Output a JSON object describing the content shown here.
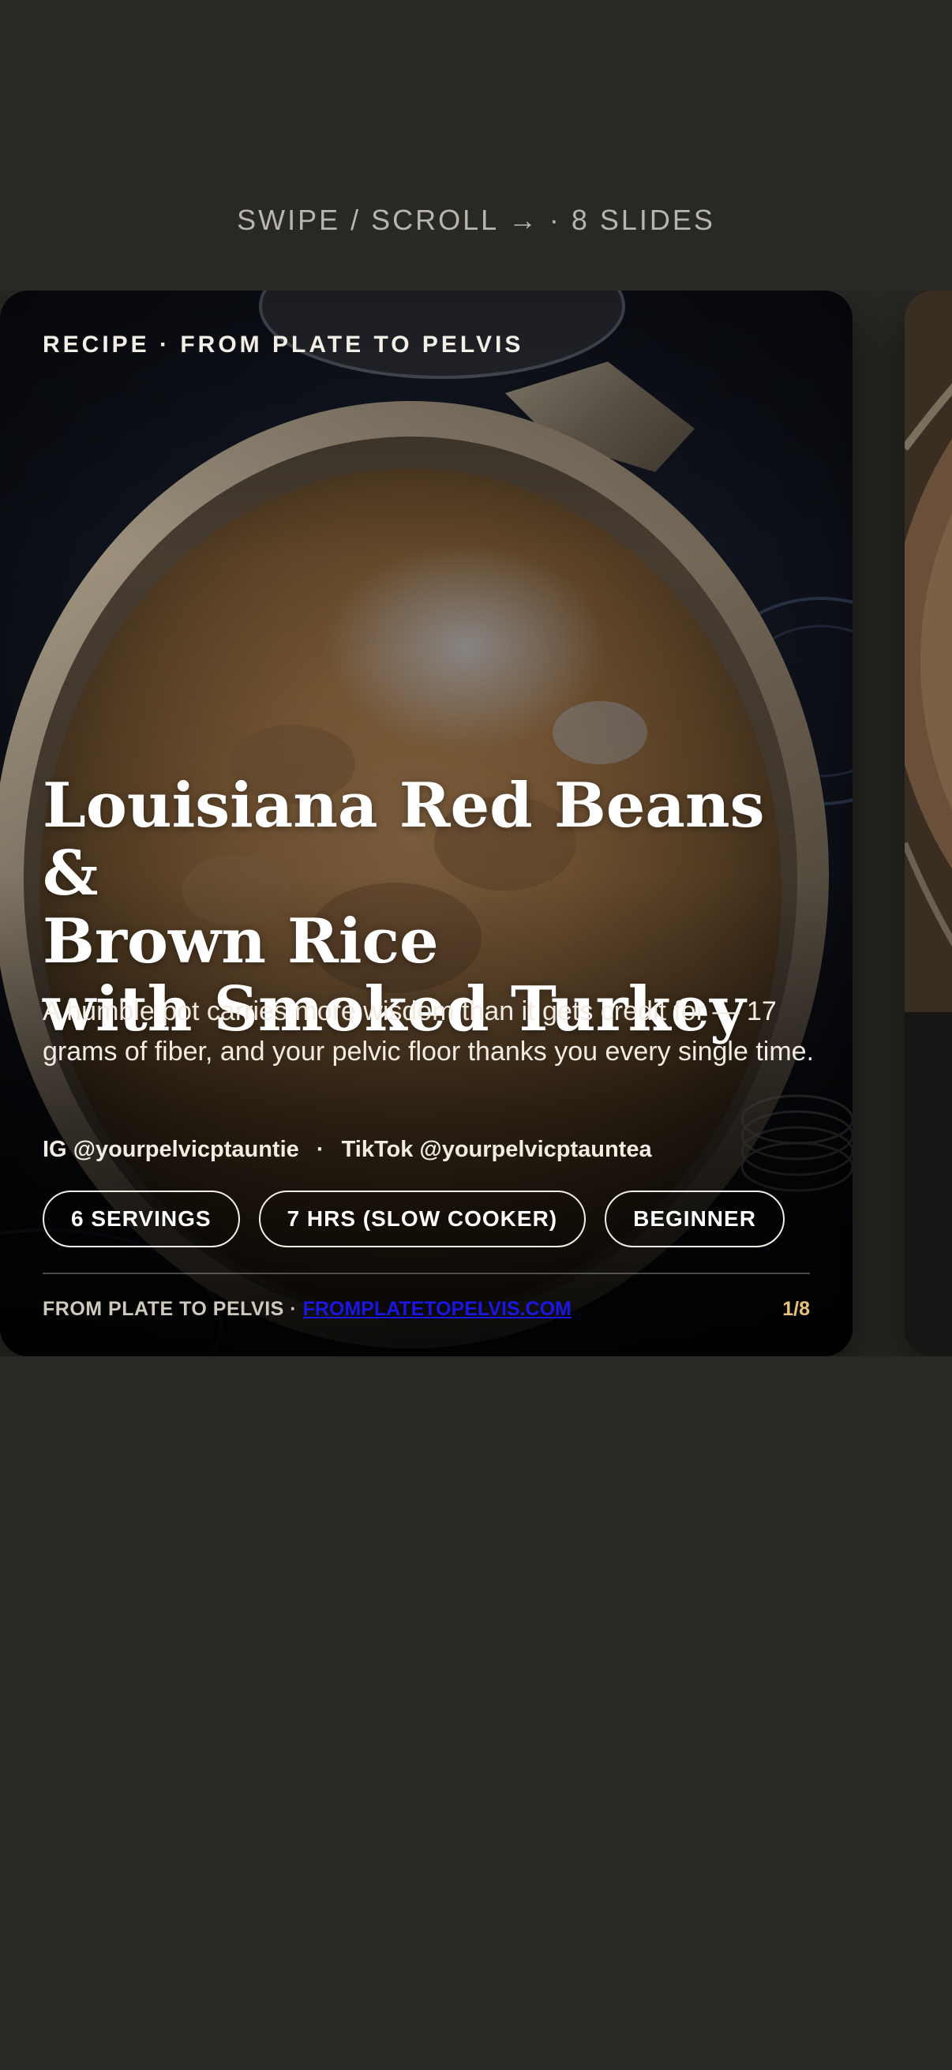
{
  "hint": {
    "text": "SWIPE / SCROLL →  ·  8 SLIDES"
  },
  "slide1": {
    "eyebrow": "RECIPE · FROM PLATE TO PELVIS",
    "title_lines": [
      "Louisiana Red Beans &",
      "Brown Rice",
      "with Smoked Turkey"
    ],
    "subtitle": "A humble pot carries more wisdom than it gets credit for — 17 grams of fiber, and your pelvic floor thanks you every single time.",
    "socials": {
      "instagram": "IG @yourpelvicptauntie",
      "separator": "·",
      "tiktok": "TikTok @yourpelvicptauntea"
    },
    "chips": [
      "6 SERVINGS",
      "7 HRS (SLOW COOKER)",
      "BEGINNER"
    ],
    "footer": {
      "brand": "FROM PLATE TO PELVIS · ",
      "link": "FROMPLATETOPELVIS.COM",
      "page": "1/8"
    }
  },
  "colors": {
    "background": "#282824",
    "accent_page": "#e8c27a",
    "link": "#1a16e6"
  },
  "icons": {
    "arrow": "right-arrow"
  }
}
